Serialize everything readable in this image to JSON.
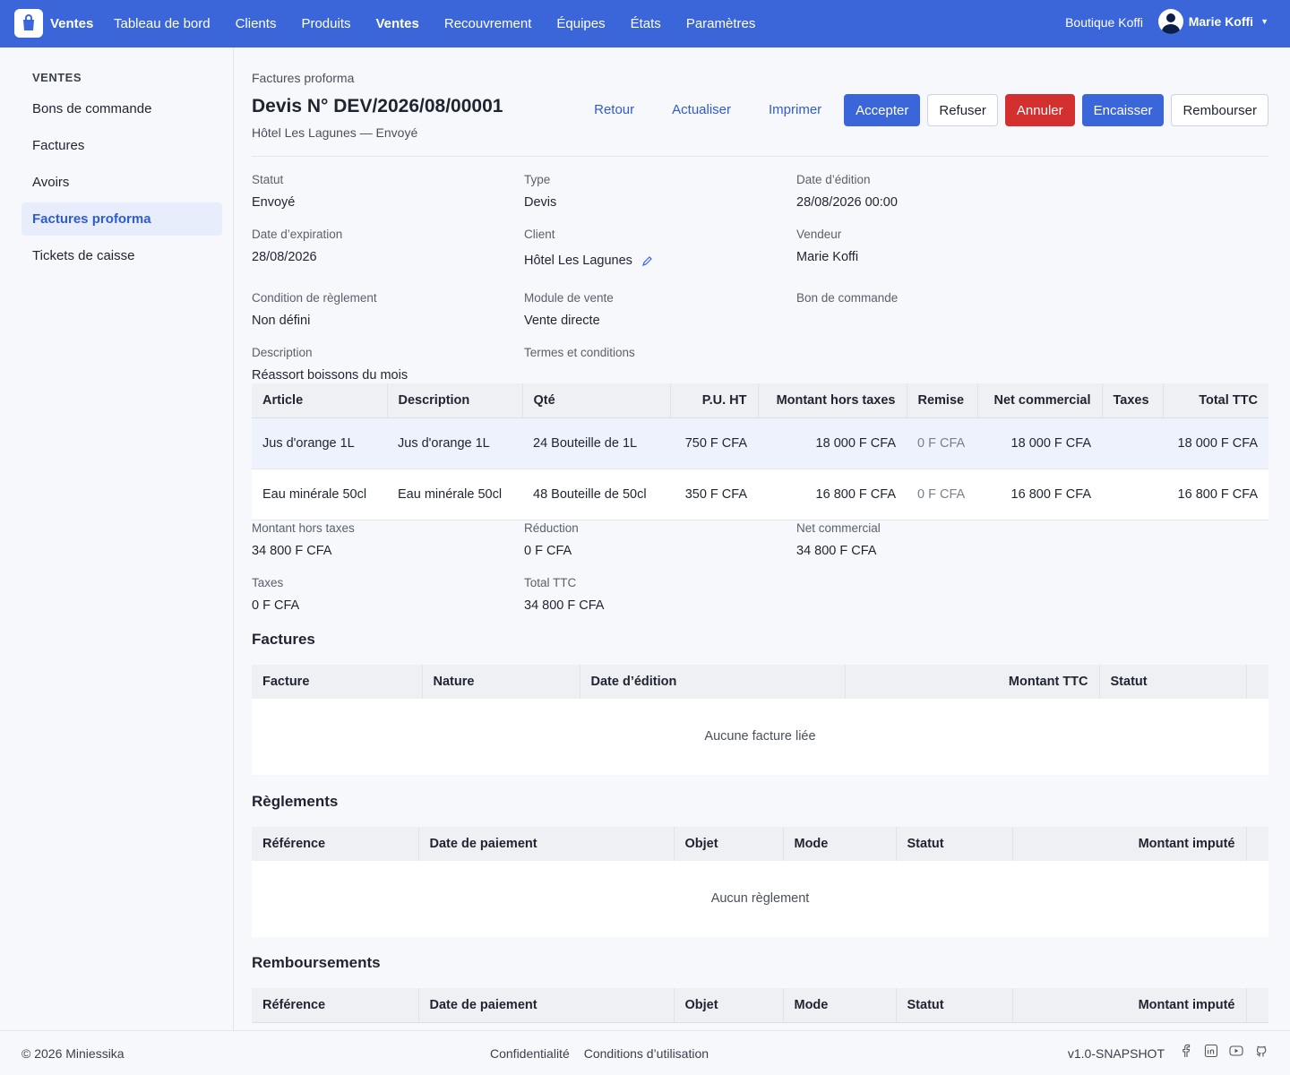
{
  "topbar": {
    "app_name": "Ventes",
    "nav": [
      "Tableau de bord",
      "Clients",
      "Produits",
      "Ventes",
      "Recouvrement",
      "Équipes",
      "États",
      "Paramètres"
    ],
    "active_nav": "Ventes",
    "shop": "Boutique Koffi",
    "user": "Marie Koffi"
  },
  "sidebar": {
    "title": "VENTES",
    "items": [
      "Bons de commande",
      "Factures",
      "Avoirs",
      "Factures proforma",
      "Tickets de caisse"
    ],
    "active": "Factures proforma"
  },
  "header": {
    "breadcrumb": "Factures proforma",
    "title": "Devis N° DEV/2026/08/00001",
    "subtitle": "Hôtel Les Lagunes — Envoyé",
    "actions": {
      "back": "Retour",
      "refresh": "Actualiser",
      "print": "Imprimer",
      "accept": "Accepter",
      "refuse": "Refuser",
      "cancel": "Annuler",
      "collect": "Encaisser",
      "refund": "Rembourser"
    }
  },
  "fields": {
    "status": {
      "label": "Statut",
      "value": "Envoyé"
    },
    "type": {
      "label": "Type",
      "value": "Devis"
    },
    "issue_date": {
      "label": "Date d’édition",
      "value": "28/08/2026 00:00"
    },
    "expiry_date": {
      "label": "Date d’expiration",
      "value": "28/08/2026"
    },
    "client": {
      "label": "Client",
      "value": "Hôtel Les Lagunes"
    },
    "seller": {
      "label": "Vendeur",
      "value": "Marie Koffi"
    },
    "payment_terms": {
      "label": "Condition de règlement",
      "value": "Non défini"
    },
    "sales_module": {
      "label": "Module de vente",
      "value": "Vente directe"
    },
    "purchase_order": {
      "label": "Bon de commande",
      "value": ""
    },
    "description": {
      "label": "Description",
      "value": "Réassort boissons du mois"
    },
    "terms": {
      "label": "Termes et conditions",
      "value": ""
    }
  },
  "lines": {
    "headers": [
      "Article",
      "Description",
      "Qté",
      "P.U. HT",
      "Montant hors taxes",
      "Remise",
      "Net commercial",
      "Taxes",
      "Total TTC"
    ],
    "rows": [
      {
        "article": "Jus d'orange 1L",
        "description": "Jus d'orange 1L",
        "qty": "24 Bouteille de 1L",
        "unit_price": "750 F CFA",
        "amount_ht": "18 000 F CFA",
        "discount": "0 F CFA",
        "net": "18 000 F CFA",
        "taxes": "",
        "total": "18 000 F CFA"
      },
      {
        "article": "Eau minérale 50cl",
        "description": "Eau minérale 50cl",
        "qty": "48 Bouteille de 50cl",
        "unit_price": "350 F CFA",
        "amount_ht": "16 800 F CFA",
        "discount": "0 F CFA",
        "net": "16 800 F CFA",
        "taxes": "",
        "total": "16 800 F CFA"
      }
    ]
  },
  "totals": {
    "amount_ht": {
      "label": "Montant hors taxes",
      "value": "34 800 F CFA"
    },
    "reduction": {
      "label": "Réduction",
      "value": "0 F CFA"
    },
    "net": {
      "label": "Net commercial",
      "value": "34 800 F CFA"
    },
    "taxes": {
      "label": "Taxes",
      "value": "0 F CFA"
    },
    "total": {
      "label": "Total TTC",
      "value": "34 800 F CFA"
    }
  },
  "invoices": {
    "title": "Factures",
    "headers": [
      "Facture",
      "Nature",
      "Date d’édition",
      "Montant TTC",
      "Statut"
    ],
    "empty": "Aucune facture liée"
  },
  "payments": {
    "title": "Règlements",
    "headers": [
      "Référence",
      "Date de paiement",
      "Objet",
      "Mode",
      "Statut",
      "Montant imputé"
    ],
    "empty": "Aucun règlement"
  },
  "refunds": {
    "title": "Remboursements",
    "headers": [
      "Référence",
      "Date de paiement",
      "Objet",
      "Mode",
      "Statut",
      "Montant imputé"
    ]
  },
  "footer": {
    "copyright": "© 2026 Miniessika",
    "privacy": "Confidentialité",
    "terms": "Conditions d’utilisation",
    "version": "v1.0-SNAPSHOT"
  }
}
